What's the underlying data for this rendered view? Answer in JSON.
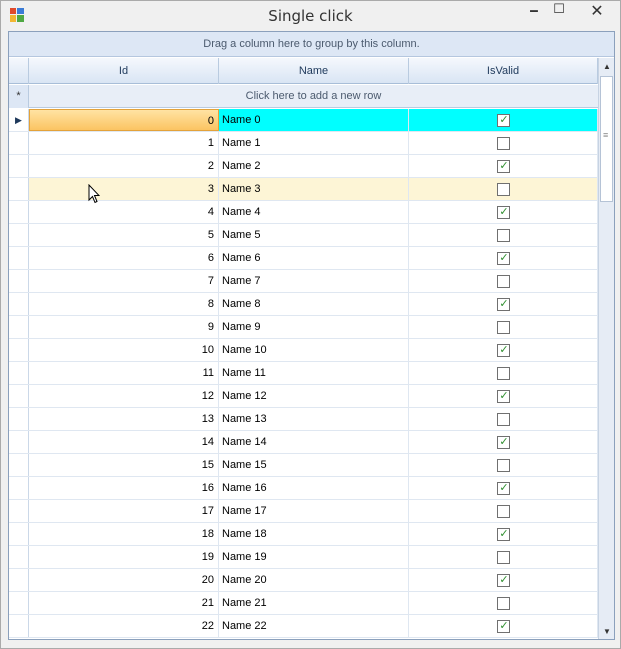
{
  "window": {
    "title": "Single click",
    "min_glyph": "🗕",
    "max_glyph": "☐",
    "close_glyph": "✕"
  },
  "grid": {
    "group_panel_text": "Drag a column here to group by this column.",
    "columns": [
      "Id",
      "Name",
      "IsValid"
    ],
    "new_row_indicator": "*",
    "new_row_text": "Click here to add a new row",
    "current_row_indicator": "▶",
    "selected_row_index": 0,
    "hover_row_index": 3,
    "rows": [
      {
        "id": "0",
        "name": "Name 0",
        "is_valid": true
      },
      {
        "id": "1",
        "name": "Name 1",
        "is_valid": false
      },
      {
        "id": "2",
        "name": "Name 2",
        "is_valid": true
      },
      {
        "id": "3",
        "name": "Name 3",
        "is_valid": false
      },
      {
        "id": "4",
        "name": "Name 4",
        "is_valid": true
      },
      {
        "id": "5",
        "name": "Name 5",
        "is_valid": false
      },
      {
        "id": "6",
        "name": "Name 6",
        "is_valid": true
      },
      {
        "id": "7",
        "name": "Name 7",
        "is_valid": false
      },
      {
        "id": "8",
        "name": "Name 8",
        "is_valid": true
      },
      {
        "id": "9",
        "name": "Name 9",
        "is_valid": false
      },
      {
        "id": "10",
        "name": "Name 10",
        "is_valid": true
      },
      {
        "id": "11",
        "name": "Name 11",
        "is_valid": false
      },
      {
        "id": "12",
        "name": "Name 12",
        "is_valid": true
      },
      {
        "id": "13",
        "name": "Name 13",
        "is_valid": false
      },
      {
        "id": "14",
        "name": "Name 14",
        "is_valid": true
      },
      {
        "id": "15",
        "name": "Name 15",
        "is_valid": false
      },
      {
        "id": "16",
        "name": "Name 16",
        "is_valid": true
      },
      {
        "id": "17",
        "name": "Name 17",
        "is_valid": false
      },
      {
        "id": "18",
        "name": "Name 18",
        "is_valid": true
      },
      {
        "id": "19",
        "name": "Name 19",
        "is_valid": false
      },
      {
        "id": "20",
        "name": "Name 20",
        "is_valid": true
      },
      {
        "id": "21",
        "name": "Name 21",
        "is_valid": false
      },
      {
        "id": "22",
        "name": "Name 22",
        "is_valid": true
      }
    ]
  },
  "colors": {
    "selected_cell": "#00ffff",
    "current_cell": "#fbc462",
    "hover_row": "#fdf5d6",
    "check_mark": "#2f8f2f"
  },
  "icons": {
    "app": "app-icon",
    "scroll_up": "▲",
    "scroll_down": "▼",
    "scroll_grip": "≡"
  }
}
